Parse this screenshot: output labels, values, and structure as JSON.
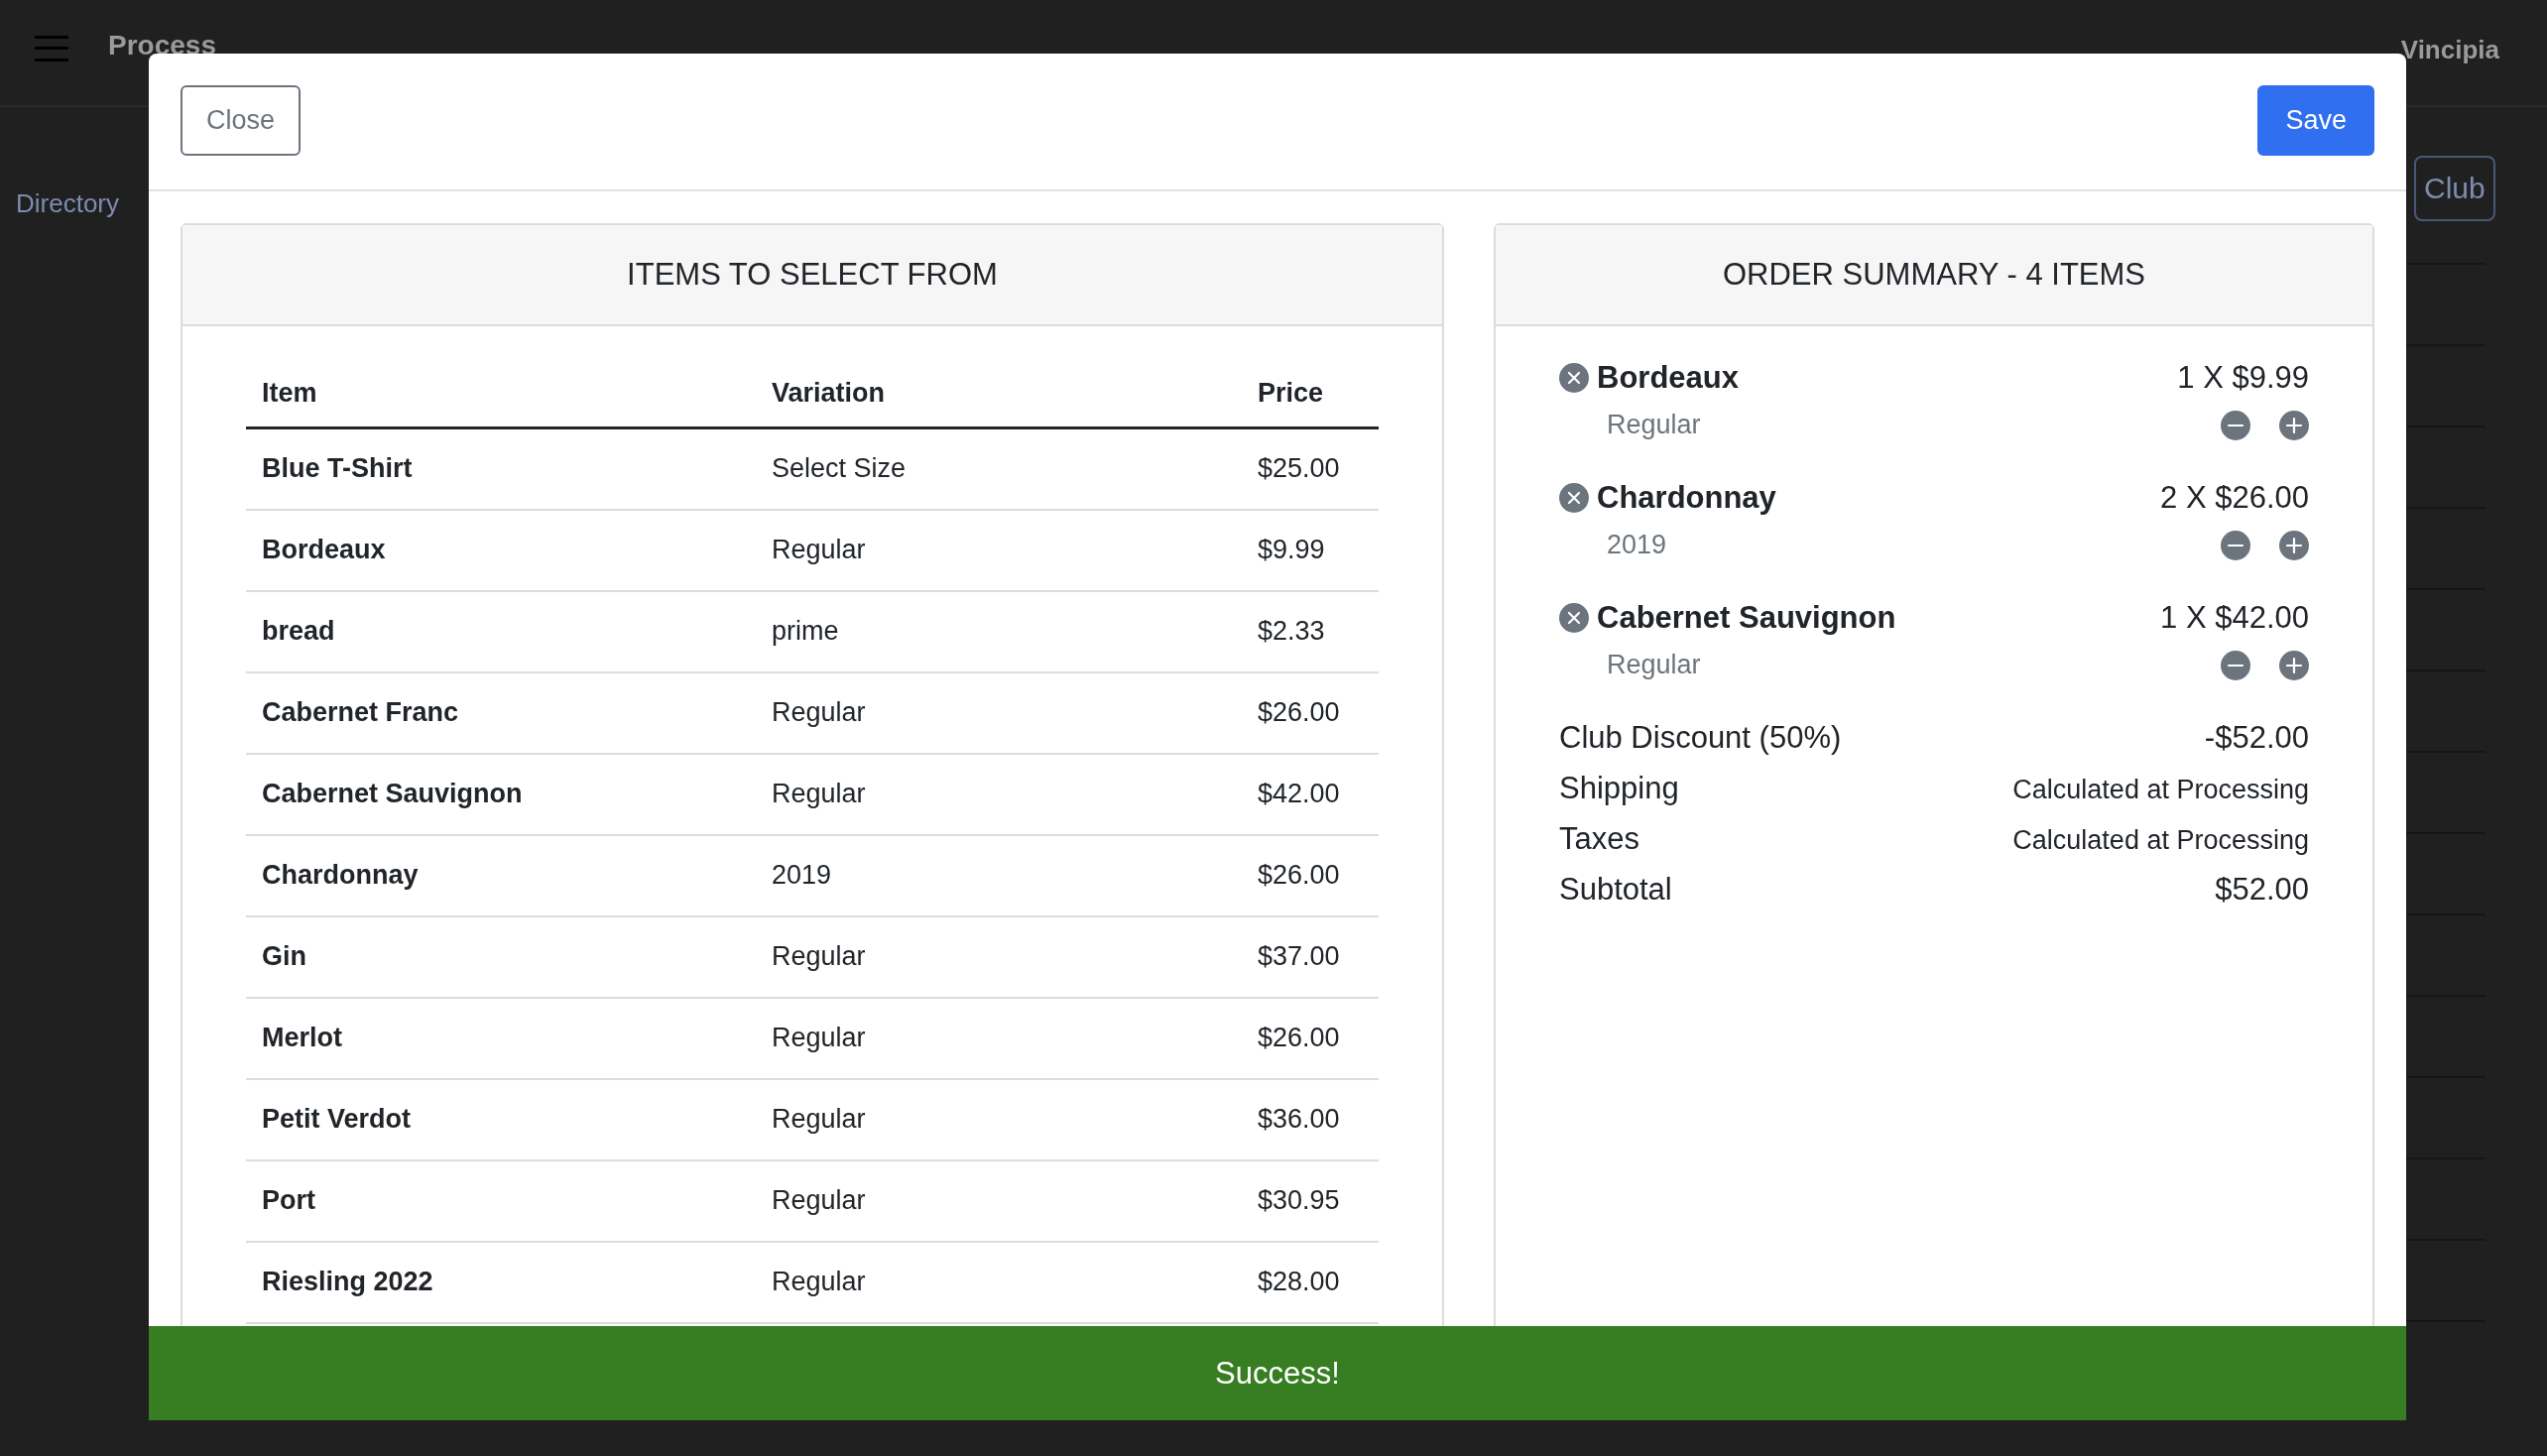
{
  "background": {
    "title": "Process",
    "brand": "Vincipia",
    "link": "Directory",
    "button": "Club"
  },
  "modal": {
    "close": "Close",
    "save": "Save"
  },
  "items_panel": {
    "title": "ITEMS TO SELECT FROM",
    "columns": [
      "Item",
      "Variation",
      "Price"
    ],
    "rows": [
      {
        "item": "Blue T-Shirt",
        "variation": "Select Size",
        "price": "$25.00"
      },
      {
        "item": "Bordeaux",
        "variation": "Regular",
        "price": "$9.99"
      },
      {
        "item": "bread",
        "variation": "prime",
        "price": "$2.33"
      },
      {
        "item": "Cabernet Franc",
        "variation": "Regular",
        "price": "$26.00"
      },
      {
        "item": "Cabernet Sauvignon",
        "variation": "Regular",
        "price": "$42.00"
      },
      {
        "item": "Chardonnay",
        "variation": "2019",
        "price": "$26.00"
      },
      {
        "item": "Gin",
        "variation": "Regular",
        "price": "$37.00"
      },
      {
        "item": "Merlot",
        "variation": "Regular",
        "price": "$26.00"
      },
      {
        "item": "Petit Verdot",
        "variation": "Regular",
        "price": "$36.00"
      },
      {
        "item": "Port",
        "variation": "Regular",
        "price": "$30.95"
      },
      {
        "item": "Riesling 2022",
        "variation": "Regular",
        "price": "$28.00"
      }
    ]
  },
  "summary": {
    "title": "ORDER SUMMARY - 4 ITEMS",
    "lines": [
      {
        "name": "Bordeaux",
        "variation": "Regular",
        "quantity": "1 X $9.99"
      },
      {
        "name": "Chardonnay",
        "variation": "2019",
        "quantity": "2 X $26.00"
      },
      {
        "name": "Cabernet Sauvignon",
        "variation": "Regular",
        "quantity": "1 X $42.00"
      }
    ],
    "totals": [
      {
        "label": "Club Discount (50%)",
        "value": "-$52.00",
        "kind": "amount"
      },
      {
        "label": "Shipping",
        "value": "Calculated at Processing",
        "kind": "note"
      },
      {
        "label": "Taxes",
        "value": "Calculated at Processing",
        "kind": "note"
      },
      {
        "label": "Subtotal",
        "value": "$52.00",
        "kind": "amount"
      }
    ]
  },
  "toast": {
    "message": "Success!"
  }
}
